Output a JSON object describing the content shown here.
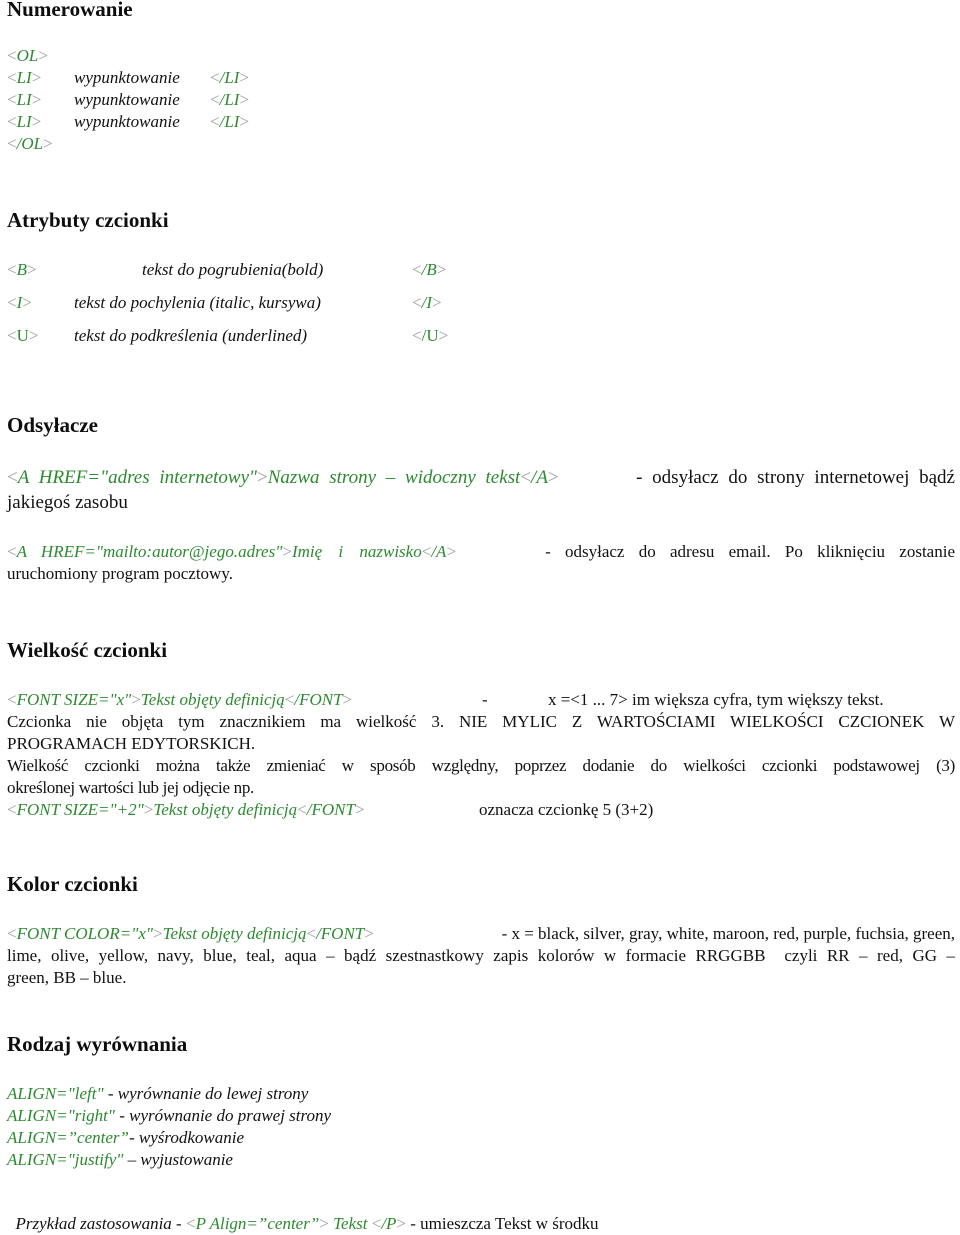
{
  "sections": {
    "numerowanie": {
      "heading": "Numerowanie",
      "open_tag": "OL",
      "close_tag": "/OL",
      "items": [
        {
          "open": "LI",
          "text": "wypunktowanie",
          "close": "/LI"
        },
        {
          "open": "LI",
          "text": "wypunktowanie",
          "close": "/LI"
        },
        {
          "open": "LI",
          "text": "wypunktowanie",
          "close": "/LI"
        }
      ]
    },
    "atrybuty": {
      "heading": "Atrybuty czcionki",
      "rows": [
        {
          "open": "B",
          "text": "tekst do pogrubienia(bold)",
          "close": "/B"
        },
        {
          "open": "I",
          "text": "tekst do pochylenia (italic, kursywa)",
          "close": "/I"
        },
        {
          "open": "U",
          "text": "tekst do podkreślenia (underlined)",
          "close": "/U"
        }
      ]
    },
    "odsylacze": {
      "heading": "Odsyłacze",
      "link1": {
        "tag_open": "A HREF=\"adres internetowy\"",
        "label": "Nazwa strony – widoczny tekst",
        "tag_close": "/A",
        "desc_line1": "- odsyłacz do strony internetowej bądź",
        "desc_line2": "jakiegoś zasobu"
      },
      "link2": {
        "tag_open": "A HREF=\"mailto:autor@jego.adres\"",
        "label": "Imię i nazwisko",
        "tag_close": "/A",
        "desc_line1": "- odsyłacz do adresu email. Po kliknięciu zostanie",
        "desc_line2": "uruchomiony program pocztowy."
      }
    },
    "wielkosc": {
      "heading": "Wielkość czcionki",
      "line1_tag_open": "FONT SIZE=\"x\"",
      "line1_label": "Tekst objęty definicją",
      "line1_tag_close": "/FONT",
      "line1_dash": "-",
      "line1_desc": "x =<1 ... 7> im większa cyfra, tym większy tekst.",
      "line2": "Czcionka nie objęta tym znacznikiem ma wielkość 3. NIE MYLIC Z WARTOŚCIAMI WIELKOŚCI CZCIONEK W",
      "line3": "PROGRAMACH EDYTORSKICH.",
      "line4": "Wielkość czcionki można także zmieniać w sposób względny, poprzez dodanie do wielkości czcionki podstawowej (3)",
      "line5": "określonej wartości lub jej odjęcie np.",
      "line6_tag_open": "FONT SIZE=\"+2\"",
      "line6_label": "Tekst objęty definicją",
      "line6_tag_close": "/FONT",
      "line6_desc": "oznacza czcionkę 5 (3+2)"
    },
    "kolor": {
      "heading": "Kolor czcionki",
      "tag_open": "FONT COLOR=\"x\"",
      "label": "Tekst objęty definicją",
      "tag_close": "/FONT",
      "line1_desc": "- x = black, silver, gray, white, maroon, red, purple, fuchsia, green,",
      "line2": "lime, olive, yellow, navy, blue, teal, aqua – bądź szestnastkowy zapis kolorów w formacie RRGGBB  czyli RR – red, GG –",
      "line3": "green, BB – blue."
    },
    "wyrownanie": {
      "heading": "Rodzaj wyrównania",
      "rows": [
        {
          "code": "ALIGN=\"left\"",
          "desc": " - wyrównanie do lewej strony"
        },
        {
          "code": "ALIGN=\"right\"",
          "desc": " - wyrównanie do prawej strony"
        },
        {
          "code": "ALIGN=”center”",
          "desc": "- wyśrodkowanie"
        },
        {
          "code": "ALIGN=\"justify\"",
          "desc": " – wyjustowanie"
        }
      ],
      "example_prefix": "Przykład zastosowania - ",
      "example_tag_open": "P Align=”center”",
      "example_label": " Tekst ",
      "example_tag_close": "/P",
      "example_suffix": " - umieszcza Tekst w środku"
    }
  },
  "colors": {
    "tag_green": "#2c8a30",
    "bracket_gray": "#a0a0a0",
    "text": "#111111"
  }
}
